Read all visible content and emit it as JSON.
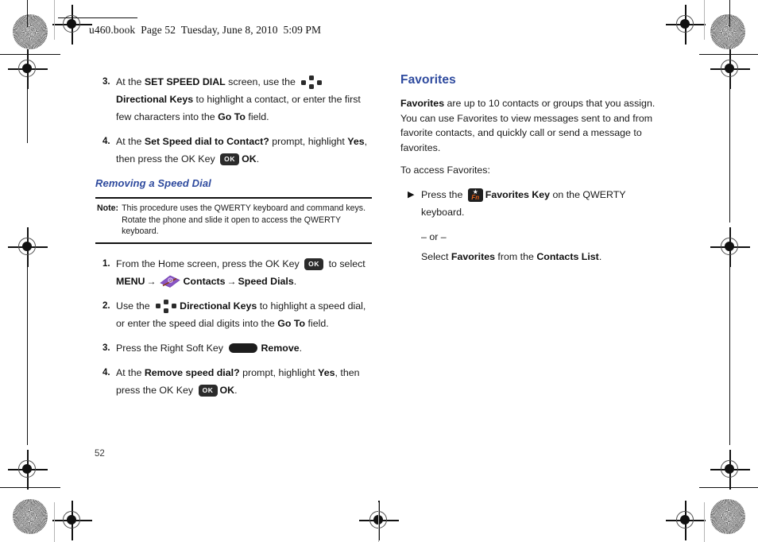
{
  "page": {
    "file_header": "u460.book  Page 52  Tuesday, June 8, 2010  5:09 PM",
    "folio": "52"
  },
  "left_column": {
    "steps_top": [
      {
        "number": "3.",
        "text_before_icon": "At the ",
        "bold1": "SET SPEED DIAL",
        "text_mid": " screen, use the ",
        "icon": "directional-keys-icon",
        "bold2": "Directional Keys",
        "text_after": " to highlight a contact, or enter the first few characters into the ",
        "bold3": "Go To",
        "text_end": " field."
      },
      {
        "number": "4.",
        "text_before": "At the ",
        "bold1": "Set Speed dial to Contact?",
        "text_mid": " prompt, highlight ",
        "bold2": "Yes",
        "text_mid2": ", then press the OK Key ",
        "icon": "ok-key-icon",
        "icon_label": "OK",
        "bold3": "OK",
        "text_end": "."
      }
    ],
    "subheading": "Removing a Speed Dial",
    "note": {
      "label": "Note:",
      "text": "This procedure uses the QWERTY keyboard and command keys. Rotate the phone and slide it open to access the QWERTY keyboard."
    },
    "steps_bottom": [
      {
        "number": "1.",
        "text_before": "From the Home screen, press the OK Key ",
        "icon": "ok-key-icon",
        "icon_label": "OK",
        "text_mid": " to select ",
        "bold1": "MENU",
        "arrow1": "→",
        "contacts_icon": "contacts-icon",
        "bold2": "Contacts",
        "arrow2": "→",
        "bold3": "Speed Dials",
        "text_end": "."
      },
      {
        "number": "2.",
        "text_before": "Use the ",
        "icon": "directional-keys-icon",
        "bold1": "Directional Keys",
        "text_mid": " to highlight a speed dial, or enter the speed dial digits into the ",
        "bold2": "Go To",
        "text_end": " field."
      },
      {
        "number": "3.",
        "text_before": "Press the Right Soft Key ",
        "icon": "right-soft-key-icon",
        "bold1": "Remove",
        "text_end": "."
      },
      {
        "number": "4.",
        "text_before": "At the ",
        "bold1": "Remove speed dial?",
        "text_mid": " prompt, highlight ",
        "bold2": "Yes",
        "text_mid2": ", then press the OK Key ",
        "icon": "ok-key-icon",
        "icon_label": "OK",
        "bold3": "OK",
        "text_end": "."
      }
    ]
  },
  "right_column": {
    "heading": "Favorites",
    "intro_bold": "Favorites",
    "intro_text": " are up to 10 contacts or groups that you assign. You can use Favorites to view messages sent to and from favorite contacts, and quickly call or send a message to favorites.",
    "lead_in": "To access Favorites:",
    "bullet": {
      "marker": "▶",
      "text_before": "Press the ",
      "icon": "favorites-fn-key-icon",
      "icon_star": "★",
      "icon_label": "Fn",
      "bold1": "Favorites Key",
      "text_end": " on the QWERTY keyboard."
    },
    "or_separator": "– or –",
    "alternative": {
      "text_before": "Select ",
      "bold1": "Favorites",
      "text_mid": " from the ",
      "bold2": "Contacts List",
      "text_end": "."
    }
  },
  "colors": {
    "heading_blue": "#2e4a9e",
    "contacts_purple": "#8a55c4",
    "fn_orange": "#e8631a",
    "key_dark": "#2b2b2b"
  }
}
